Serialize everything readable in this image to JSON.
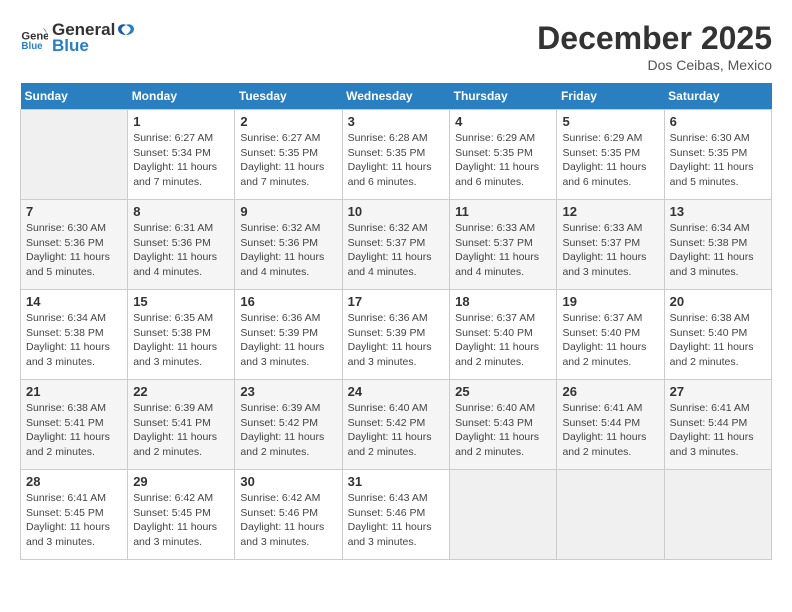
{
  "header": {
    "logo_line1": "General",
    "logo_line2": "Blue",
    "month": "December 2025",
    "location": "Dos Ceibas, Mexico"
  },
  "days_of_week": [
    "Sunday",
    "Monday",
    "Tuesday",
    "Wednesday",
    "Thursday",
    "Friday",
    "Saturday"
  ],
  "weeks": [
    [
      {
        "day": "",
        "sunrise": "",
        "sunset": "",
        "daylight": ""
      },
      {
        "day": "1",
        "sunrise": "6:27 AM",
        "sunset": "5:34 PM",
        "daylight": "11 hours and 7 minutes."
      },
      {
        "day": "2",
        "sunrise": "6:27 AM",
        "sunset": "5:35 PM",
        "daylight": "11 hours and 7 minutes."
      },
      {
        "day": "3",
        "sunrise": "6:28 AM",
        "sunset": "5:35 PM",
        "daylight": "11 hours and 6 minutes."
      },
      {
        "day": "4",
        "sunrise": "6:29 AM",
        "sunset": "5:35 PM",
        "daylight": "11 hours and 6 minutes."
      },
      {
        "day": "5",
        "sunrise": "6:29 AM",
        "sunset": "5:35 PM",
        "daylight": "11 hours and 6 minutes."
      },
      {
        "day": "6",
        "sunrise": "6:30 AM",
        "sunset": "5:35 PM",
        "daylight": "11 hours and 5 minutes."
      }
    ],
    [
      {
        "day": "7",
        "sunrise": "6:30 AM",
        "sunset": "5:36 PM",
        "daylight": "11 hours and 5 minutes."
      },
      {
        "day": "8",
        "sunrise": "6:31 AM",
        "sunset": "5:36 PM",
        "daylight": "11 hours and 4 minutes."
      },
      {
        "day": "9",
        "sunrise": "6:32 AM",
        "sunset": "5:36 PM",
        "daylight": "11 hours and 4 minutes."
      },
      {
        "day": "10",
        "sunrise": "6:32 AM",
        "sunset": "5:37 PM",
        "daylight": "11 hours and 4 minutes."
      },
      {
        "day": "11",
        "sunrise": "6:33 AM",
        "sunset": "5:37 PM",
        "daylight": "11 hours and 4 minutes."
      },
      {
        "day": "12",
        "sunrise": "6:33 AM",
        "sunset": "5:37 PM",
        "daylight": "11 hours and 3 minutes."
      },
      {
        "day": "13",
        "sunrise": "6:34 AM",
        "sunset": "5:38 PM",
        "daylight": "11 hours and 3 minutes."
      }
    ],
    [
      {
        "day": "14",
        "sunrise": "6:34 AM",
        "sunset": "5:38 PM",
        "daylight": "11 hours and 3 minutes."
      },
      {
        "day": "15",
        "sunrise": "6:35 AM",
        "sunset": "5:38 PM",
        "daylight": "11 hours and 3 minutes."
      },
      {
        "day": "16",
        "sunrise": "6:36 AM",
        "sunset": "5:39 PM",
        "daylight": "11 hours and 3 minutes."
      },
      {
        "day": "17",
        "sunrise": "6:36 AM",
        "sunset": "5:39 PM",
        "daylight": "11 hours and 3 minutes."
      },
      {
        "day": "18",
        "sunrise": "6:37 AM",
        "sunset": "5:40 PM",
        "daylight": "11 hours and 2 minutes."
      },
      {
        "day": "19",
        "sunrise": "6:37 AM",
        "sunset": "5:40 PM",
        "daylight": "11 hours and 2 minutes."
      },
      {
        "day": "20",
        "sunrise": "6:38 AM",
        "sunset": "5:40 PM",
        "daylight": "11 hours and 2 minutes."
      }
    ],
    [
      {
        "day": "21",
        "sunrise": "6:38 AM",
        "sunset": "5:41 PM",
        "daylight": "11 hours and 2 minutes."
      },
      {
        "day": "22",
        "sunrise": "6:39 AM",
        "sunset": "5:41 PM",
        "daylight": "11 hours and 2 minutes."
      },
      {
        "day": "23",
        "sunrise": "6:39 AM",
        "sunset": "5:42 PM",
        "daylight": "11 hours and 2 minutes."
      },
      {
        "day": "24",
        "sunrise": "6:40 AM",
        "sunset": "5:42 PM",
        "daylight": "11 hours and 2 minutes."
      },
      {
        "day": "25",
        "sunrise": "6:40 AM",
        "sunset": "5:43 PM",
        "daylight": "11 hours and 2 minutes."
      },
      {
        "day": "26",
        "sunrise": "6:41 AM",
        "sunset": "5:44 PM",
        "daylight": "11 hours and 2 minutes."
      },
      {
        "day": "27",
        "sunrise": "6:41 AM",
        "sunset": "5:44 PM",
        "daylight": "11 hours and 3 minutes."
      }
    ],
    [
      {
        "day": "28",
        "sunrise": "6:41 AM",
        "sunset": "5:45 PM",
        "daylight": "11 hours and 3 minutes."
      },
      {
        "day": "29",
        "sunrise": "6:42 AM",
        "sunset": "5:45 PM",
        "daylight": "11 hours and 3 minutes."
      },
      {
        "day": "30",
        "sunrise": "6:42 AM",
        "sunset": "5:46 PM",
        "daylight": "11 hours and 3 minutes."
      },
      {
        "day": "31",
        "sunrise": "6:43 AM",
        "sunset": "5:46 PM",
        "daylight": "11 hours and 3 minutes."
      },
      {
        "day": "",
        "sunrise": "",
        "sunset": "",
        "daylight": ""
      },
      {
        "day": "",
        "sunrise": "",
        "sunset": "",
        "daylight": ""
      },
      {
        "day": "",
        "sunrise": "",
        "sunset": "",
        "daylight": ""
      }
    ]
  ]
}
